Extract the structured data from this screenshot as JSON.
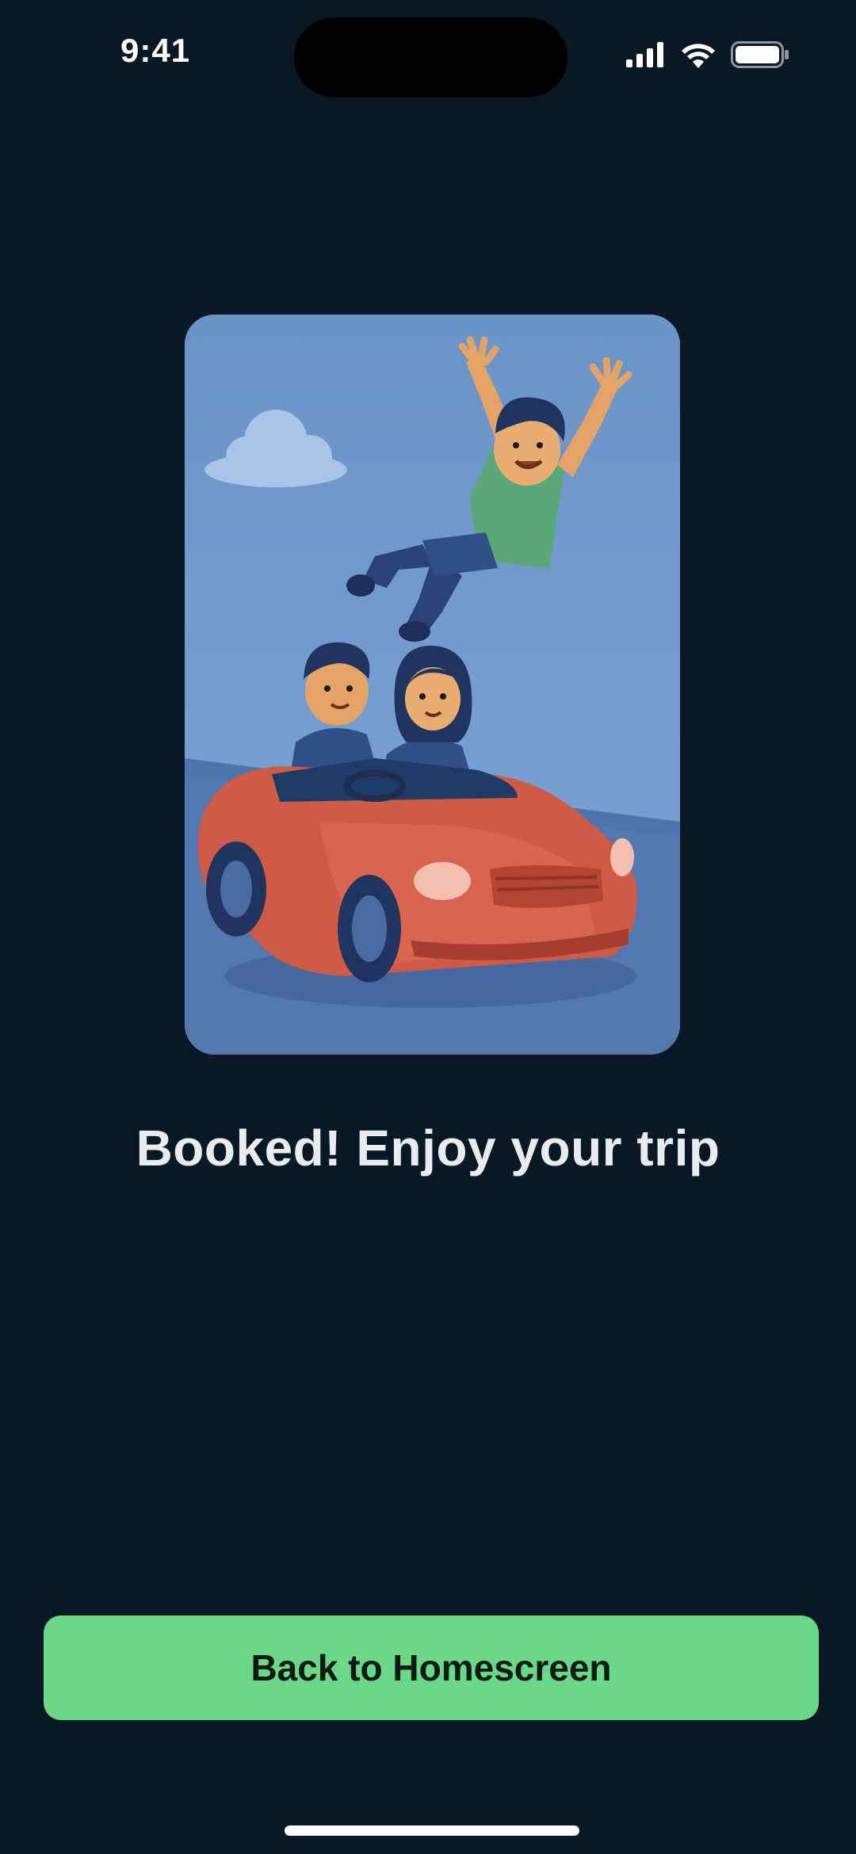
{
  "status_bar": {
    "time": "9:41",
    "icons": [
      "cellular-signal-icon",
      "wifi-icon",
      "battery-icon"
    ]
  },
  "illustration": {
    "subject": "illustration-friends-in-red-convertible",
    "colors": {
      "sky": "#6f96c8",
      "car": "#cf5a45",
      "shirt_green": "#5aa877",
      "denim": "#2f4f86"
    }
  },
  "main": {
    "headline": "Booked! Enjoy your trip"
  },
  "actions": {
    "back_home_label": "Back to Homescreen"
  },
  "theme": {
    "background": "#081824",
    "accent": "#6ad888"
  }
}
